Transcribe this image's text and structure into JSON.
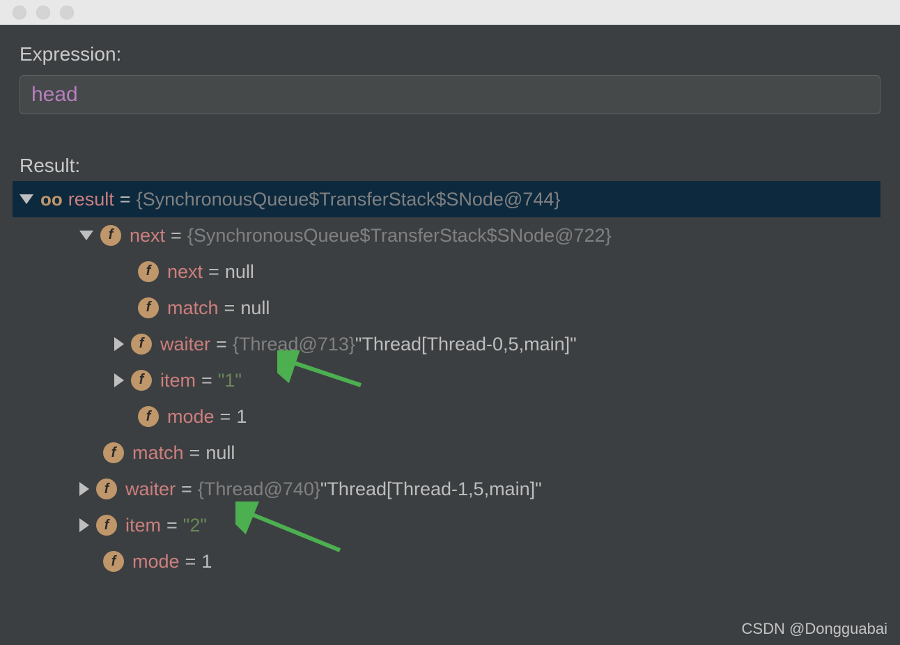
{
  "labels": {
    "expression": "Expression:",
    "result": "Result:"
  },
  "expression_value": "head",
  "tree": {
    "result": {
      "name": "result",
      "value": "{SynchronousQueue$TransferStack$SNode@744}"
    },
    "next": {
      "name": "next",
      "value": "{SynchronousQueue$TransferStack$SNode@722}"
    },
    "next_next": {
      "name": "next",
      "value": "null"
    },
    "next_match": {
      "name": "match",
      "value": "null"
    },
    "next_waiter": {
      "name": "waiter",
      "value_dim": "{Thread@713}",
      "value_lit": " \"Thread[Thread-0,5,main]\""
    },
    "next_item": {
      "name": "item",
      "value": "\"1\""
    },
    "next_mode": {
      "name": "mode",
      "value": "1"
    },
    "match": {
      "name": "match",
      "value": "null"
    },
    "waiter": {
      "name": "waiter",
      "value_dim": "{Thread@740}",
      "value_lit": " \"Thread[Thread-1,5,main]\""
    },
    "item": {
      "name": "item",
      "value": "\"2\""
    },
    "mode": {
      "name": "mode",
      "value": "1"
    }
  },
  "watermark": "CSDN @Dongguabai"
}
